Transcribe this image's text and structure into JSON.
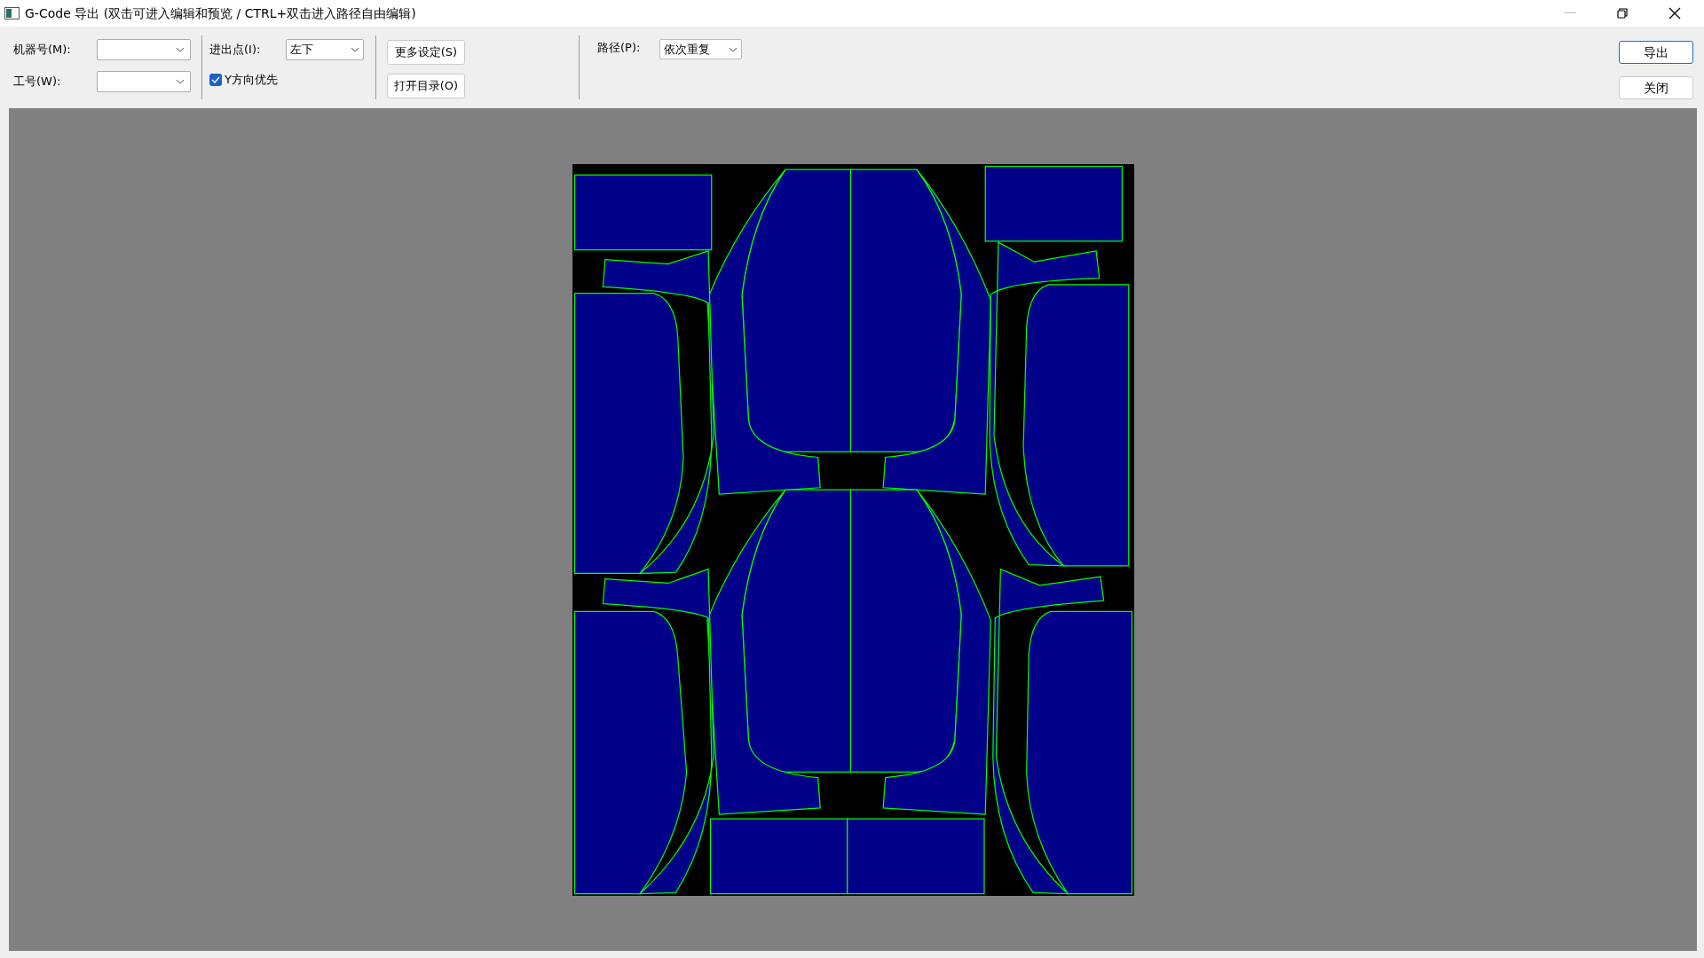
{
  "window": {
    "title": "G-Code 导出 (双击可进入编辑和预览 / CTRL+双击进入路径自由编辑)"
  },
  "toolbar": {
    "machine": {
      "label": "机器号(M):"
    },
    "worker": {
      "label": "工号(W):"
    },
    "entry_point": {
      "label": "进出点(I):",
      "value": "左下"
    },
    "y_first": {
      "label": "Y方向优先",
      "checked": true
    },
    "buttons": [
      "更多设定(S)",
      "打开目录(O)"
    ],
    "path": {
      "label": "路径(P):",
      "value": "依次重复"
    },
    "actions": [
      {
        "label": "导出",
        "default": true
      },
      {
        "label": "关闭",
        "default": false
      }
    ]
  }
}
